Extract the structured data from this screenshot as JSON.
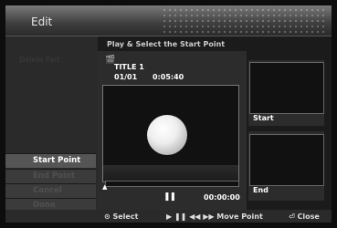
{
  "title": "Edit",
  "dimmed_label": "Delete Part",
  "header": "Play & Select the Start Point",
  "clip": {
    "icon": "clip-icon",
    "title": "TITLE 1",
    "chapter": "01/01",
    "duration": "0:05:40"
  },
  "playback": {
    "state": "paused",
    "state_glyph": "❚❚",
    "time": "00:00:00",
    "progress": 0
  },
  "menu": [
    {
      "label": "Start Point",
      "active": true
    },
    {
      "label": "End Point",
      "active": false
    },
    {
      "label": "Cancel",
      "active": false
    },
    {
      "label": "Done",
      "active": false
    }
  ],
  "thumbnails": {
    "start_label": "Start",
    "end_label": "End"
  },
  "footer": {
    "select": "⊙ Select",
    "move": "▶ ❚❚ ◀◀ ▶▶ Move Point",
    "close": "⏎ Close"
  }
}
